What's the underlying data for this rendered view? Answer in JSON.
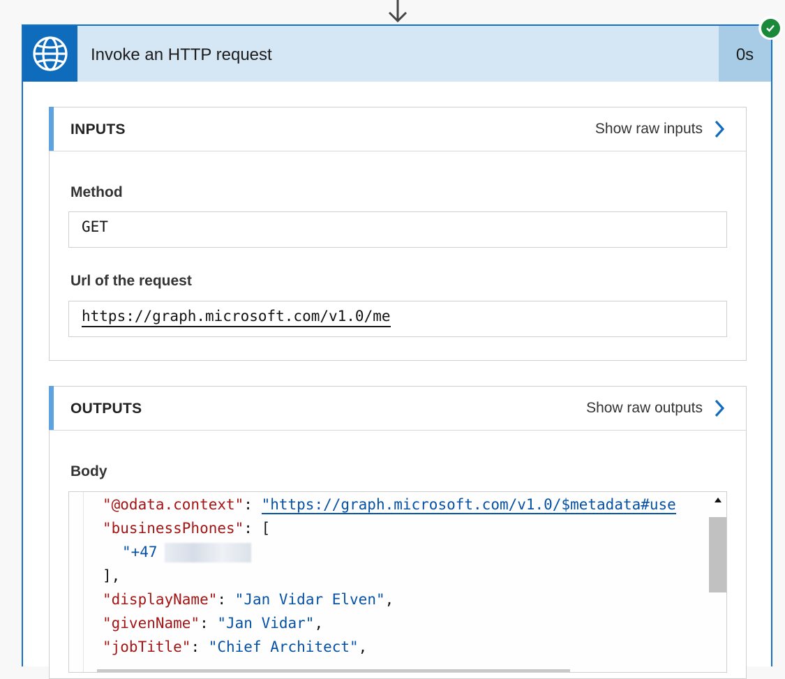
{
  "action": {
    "title": "Invoke an HTTP request",
    "duration": "0s",
    "status_icon": "success-check-icon",
    "icon": "globe-icon",
    "colors": {
      "accent": "#0f6cbd",
      "header_bg": "#d5e6f5",
      "success": "#1a8a3a"
    }
  },
  "inputs": {
    "heading": "INPUTS",
    "raw_link": "Show raw inputs",
    "method_label": "Method",
    "method_value": "GET",
    "url_label": "Url of the request",
    "url_value": "https://graph.microsoft.com/v1.0/me"
  },
  "outputs": {
    "heading": "OUTPUTS",
    "raw_link": "Show raw outputs",
    "body_label": "Body",
    "body_lines": [
      {
        "key": "\"@odata.context\"",
        "sep": ": ",
        "value": "\"https://graph.microsoft.com/v1.0/$metadata#use"
      },
      {
        "key": "\"businessPhones\"",
        "sep": ": ",
        "value": "["
      },
      {
        "value": "\"+47"
      },
      {
        "value": "],"
      },
      {
        "key": "\"displayName\"",
        "sep": ": ",
        "value": "\"Jan Vidar Elven\"",
        "tail": ","
      },
      {
        "key": "\"givenName\"",
        "sep": ": ",
        "value": "\"Jan Vidar\"",
        "tail": ","
      },
      {
        "key": "\"jobTitle\"",
        "sep": ": ",
        "value": "\"Chief Architect\"",
        "tail": ","
      }
    ]
  }
}
